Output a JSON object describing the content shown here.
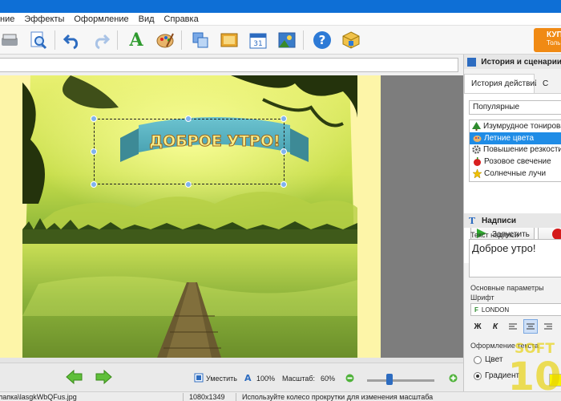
{
  "menu": [
    "ние",
    "Эффекты",
    "Оформление",
    "Вид",
    "Справка"
  ],
  "toolbar": {
    "icons": [
      "scanner-icon",
      "zoom-page-icon",
      "undo-icon",
      "redo-icon",
      "text-icon",
      "palette-icon",
      "crop-icon",
      "frame-icon",
      "calendar-icon",
      "photo-icon",
      "help-icon",
      "package-icon"
    ],
    "buy_label": "КУП",
    "buy_sub": "Толь"
  },
  "canvas": {
    "banner_text": "ДОБРОЕ УТРО!"
  },
  "bottom": {
    "fit_label": "Уместить",
    "zoom_100": "100%",
    "scale_label": "Масштаб:",
    "scale_value": "60%",
    "scale_fraction": 0.6
  },
  "status": {
    "path": "лапка\\lasgkWbQFus.jpg",
    "dimensions": "1080x1349",
    "hint": "Используйте колесо прокрутки для изменения масштаба"
  },
  "panel": {
    "history_header": "История и сценарии",
    "tabs": [
      "История действий",
      "С"
    ],
    "preset_select": "Популярные",
    "presets": [
      {
        "label": "Изумрудное тонирование",
        "icon": "tree-icon",
        "color": "#2e8b2e"
      },
      {
        "label": "Летние цвета",
        "icon": "palette-icon",
        "color": "#c8882a",
        "selected": true
      },
      {
        "label": "Повышение резкости",
        "icon": "gear-icon",
        "color": "#666666"
      },
      {
        "label": "Розовое свечение",
        "icon": "apple-icon",
        "color": "#d92020"
      },
      {
        "label": "Солнечные лучи",
        "icon": "star-icon",
        "color": "#f0c000"
      }
    ],
    "run_label": "Запустить",
    "captions_header": "Надписи",
    "caption_text_label": "Текст надписи",
    "caption_text": "Доброе утро!",
    "basic_params": "Основные параметры",
    "font_label": "Шрифт",
    "font_value": "LONDON",
    "bold": "Ж",
    "italic": "К",
    "text_design": "Оформление текста",
    "color_option": "Цвет",
    "gradient_option": "Градиент",
    "gradient_color": "#f7f200"
  },
  "watermark": {
    "top": "SOFT",
    "bottom": "10"
  }
}
